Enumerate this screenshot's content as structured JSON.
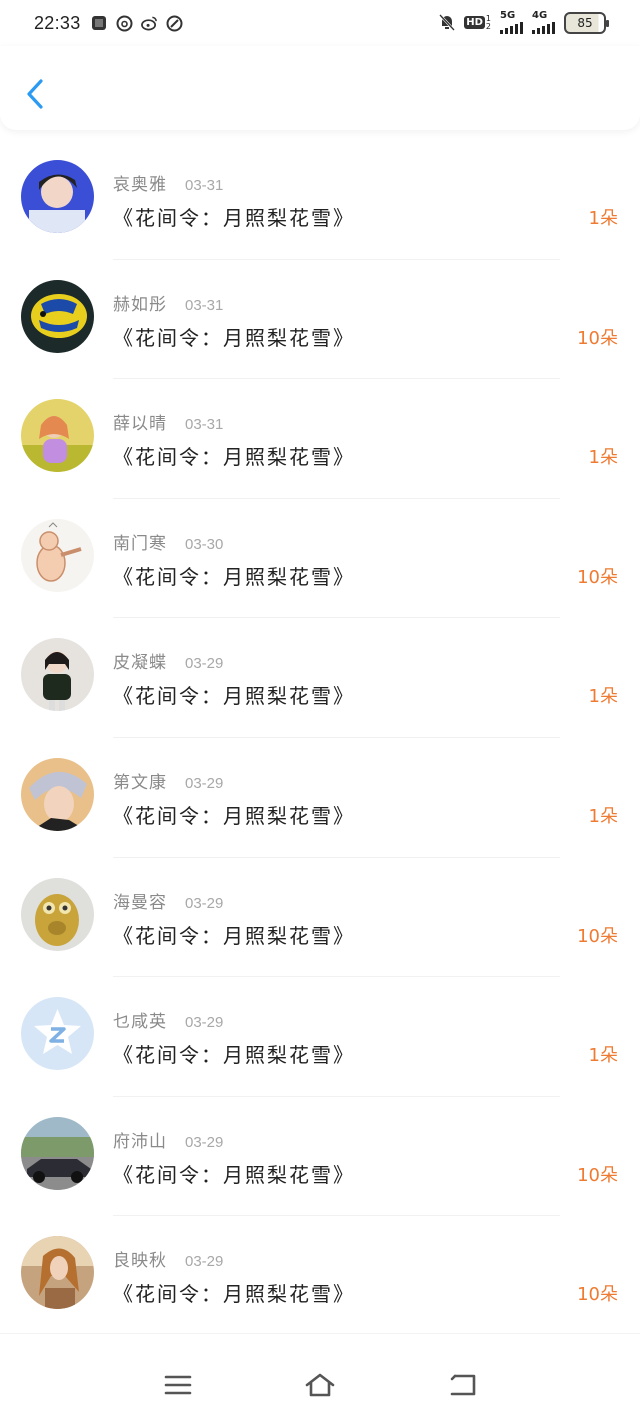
{
  "status_bar": {
    "time": "22:33",
    "hd_label": "HD",
    "sim1_label": "5G",
    "sim2_label": "4G",
    "battery_level": "85"
  },
  "header": {
    "back_icon": "chevron-left-icon",
    "accent_color": "#2b9af3"
  },
  "list": [
    {
      "name": "哀奥雅",
      "date": "03-31",
      "song": "《花间令：月照梨花雪》",
      "amount": "1朵"
    },
    {
      "name": "赫如彤",
      "date": "03-31",
      "song": "《花间令：月照梨花雪》",
      "amount": "10朵"
    },
    {
      "name": "薛以晴",
      "date": "03-31",
      "song": "《花间令：月照梨花雪》",
      "amount": "1朵"
    },
    {
      "name": "南门寒",
      "date": "03-30",
      "song": "《花间令：月照梨花雪》",
      "amount": "10朵"
    },
    {
      "name": "皮凝蝶",
      "date": "03-29",
      "song": "《花间令：月照梨花雪》",
      "amount": "1朵"
    },
    {
      "name": "第文康",
      "date": "03-29",
      "song": "《花间令：月照梨花雪》",
      "amount": "1朵"
    },
    {
      "name": "海曼容",
      "date": "03-29",
      "song": "《花间令：月照梨花雪》",
      "amount": "10朵"
    },
    {
      "name": "乜咸英",
      "date": "03-29",
      "song": "《花间令：月照梨花雪》",
      "amount": "1朵"
    },
    {
      "name": "府沛山",
      "date": "03-29",
      "song": "《花间令：月照梨花雪》",
      "amount": "10朵"
    },
    {
      "name": "良映秋",
      "date": "03-29",
      "song": "《花间令：月照梨花雪》",
      "amount": "10朵"
    }
  ],
  "nav": {
    "menu_icon": "menu-icon",
    "home_icon": "home-icon",
    "back_icon": "back-icon"
  },
  "colors": {
    "amount": "#ef7b33",
    "name": "#8a8a8a",
    "date": "#a8a8a8"
  }
}
